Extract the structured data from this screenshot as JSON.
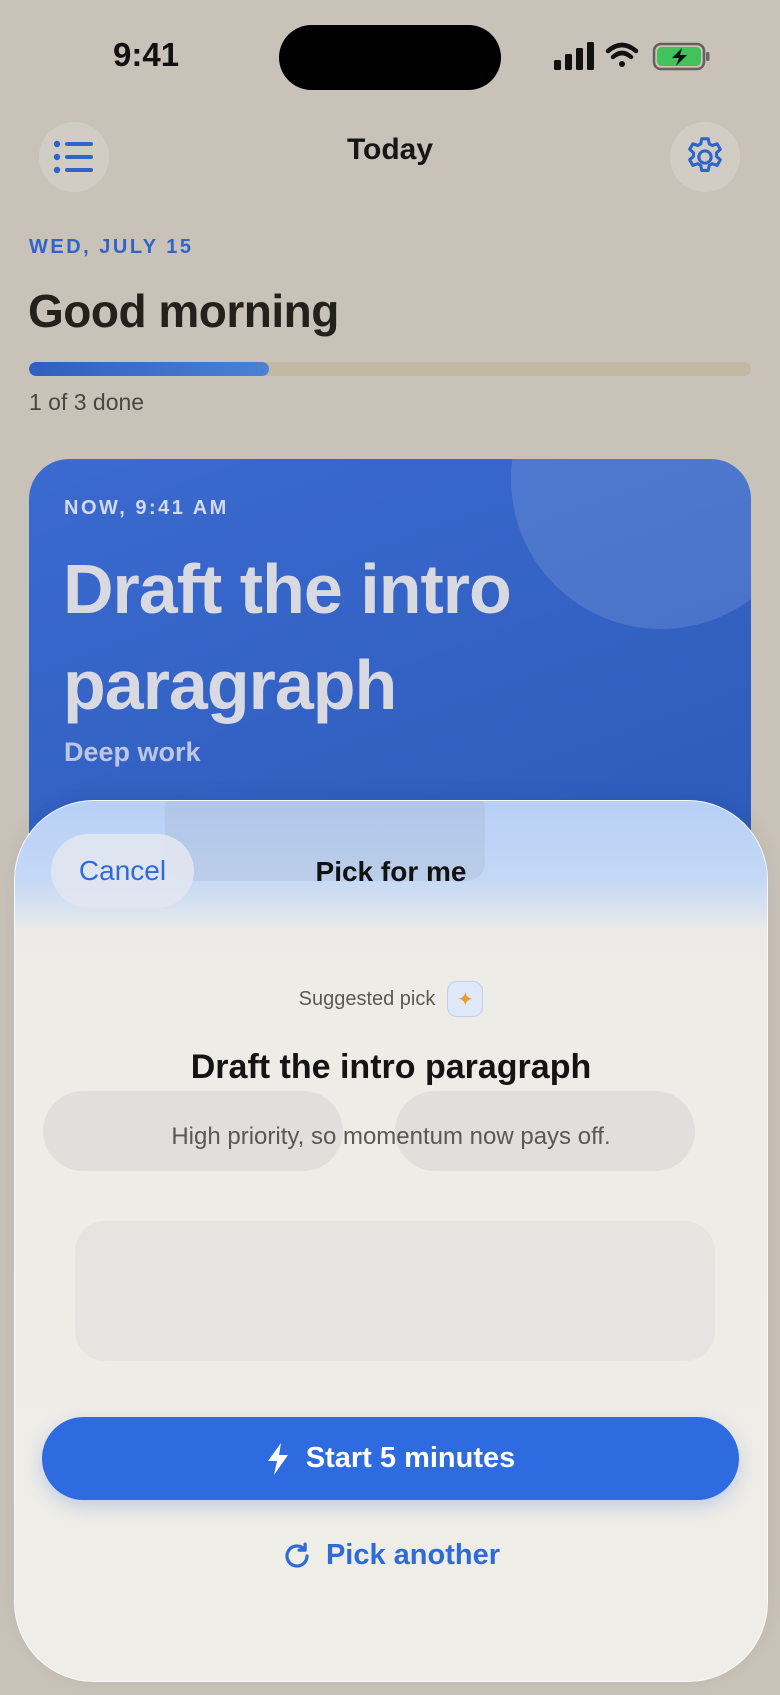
{
  "status_bar": {
    "time": "9:41"
  },
  "nav": {
    "title": "Today",
    "menu_icon": "list-icon",
    "settings_icon": "gear-icon"
  },
  "today": {
    "date_label": "WED, JULY 15",
    "greeting": "Good morning",
    "progress": {
      "fraction": 0.333,
      "text": "1 of 3 done"
    }
  },
  "current_task": {
    "time_label": "NOW, 9:41 AM",
    "title": "Draft the intro paragraph",
    "category": "Deep work"
  },
  "sheet": {
    "cancel_label": "Cancel",
    "title": "Pick for me",
    "suggested_label": "Suggested pick",
    "pick_title": "Draft the intro paragraph",
    "pick_reason": "High priority, so momentum now pays off.",
    "start_label": "Start 5 minutes",
    "another_label": "Pick another"
  },
  "colors": {
    "accent": "#2e6be0",
    "card": "#3565c8",
    "sparkle": "#f29a2e",
    "battery": "#43c15a"
  }
}
